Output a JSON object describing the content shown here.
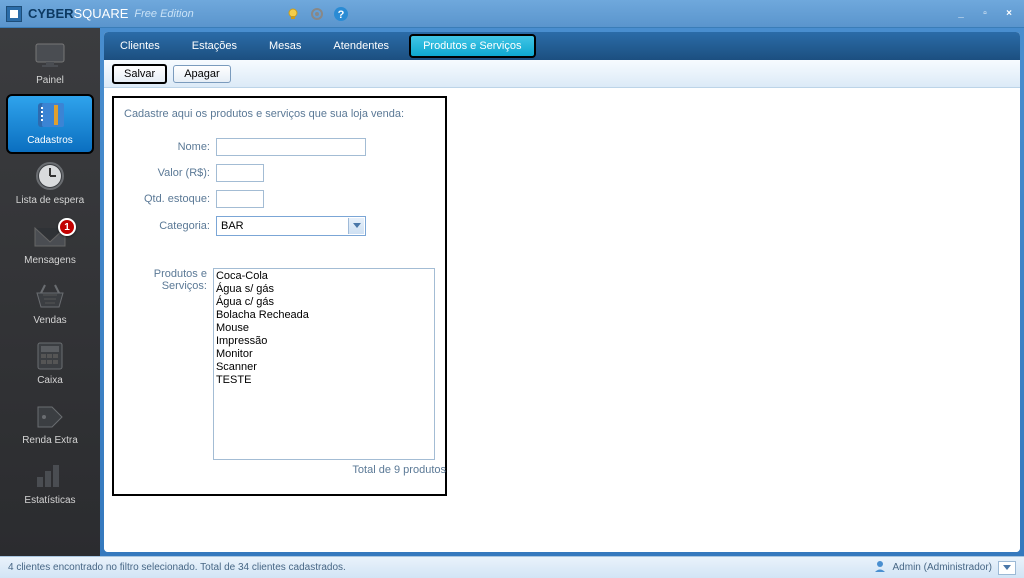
{
  "titlebar": {
    "brand_prefix": "CYBER",
    "brand_suffix": "SQUARE",
    "edition": "Free Edition"
  },
  "sidebar": {
    "items": [
      {
        "label": "Painel"
      },
      {
        "label": "Cadastros"
      },
      {
        "label": "Lista de espera"
      },
      {
        "label": "Mensagens",
        "badge": "1"
      },
      {
        "label": "Vendas"
      },
      {
        "label": "Caixa"
      },
      {
        "label": "Renda Extra"
      },
      {
        "label": "Estatísticas"
      }
    ]
  },
  "topnav": {
    "items": [
      {
        "label": "Clientes"
      },
      {
        "label": "Estações"
      },
      {
        "label": "Mesas"
      },
      {
        "label": "Atendentes"
      },
      {
        "label": "Produtos e Serviços"
      }
    ]
  },
  "toolbar": {
    "save_label": "Salvar",
    "delete_label": "Apagar"
  },
  "form": {
    "title": "Cadastre aqui os produtos e serviços que sua loja venda:",
    "name_label": "Nome:",
    "value_label": "Valor (R$):",
    "qty_label": "Qtd. estoque:",
    "category_label": "Categoria:",
    "category_value": "BAR",
    "list_label": "Produtos e Serviços:",
    "items": [
      "Coca-Cola",
      "Água s/ gás",
      "Água c/ gás",
      "Bolacha Recheada",
      "Mouse",
      "Impressão",
      "Monitor",
      "Scanner",
      "TESTE"
    ],
    "total": "Total de 9 produtos"
  },
  "statusbar": {
    "left": "4 clientes encontrado no filtro selecionado. Total de 34 clientes cadastrados.",
    "user": "Admin (Administrador)"
  }
}
